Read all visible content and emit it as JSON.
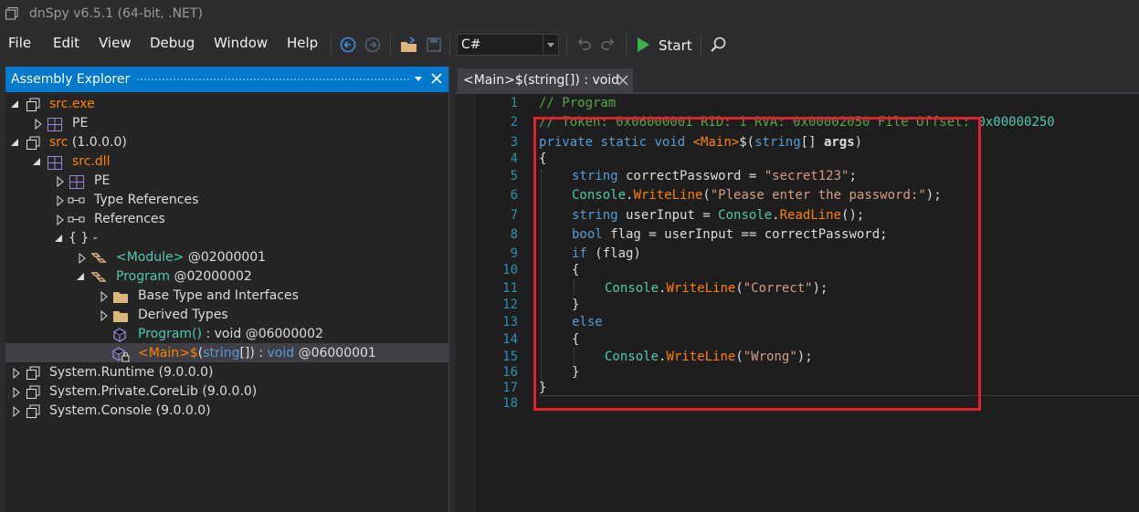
{
  "window": {
    "title": "dnSpy v6.5.1 (64-bit, .NET)"
  },
  "menu": [
    "File",
    "Edit",
    "View",
    "Debug",
    "Window",
    "Help"
  ],
  "toolbar": {
    "language": "C#",
    "start_label": "Start"
  },
  "explorer": {
    "title": "Assembly Explorer",
    "tree": [
      {
        "text": "src.exe",
        "color": "#ff8000"
      },
      {
        "text": "PE",
        "color": "#dcdcdc"
      },
      {
        "text": "src",
        "extra": " (1.0.0.0)",
        "color": "#ff8000"
      },
      {
        "text": "src.dll",
        "color": "#ff8000"
      },
      {
        "text": "PE",
        "color": "#dcdcdc"
      },
      {
        "text": "Type References",
        "color": "#dcdcdc"
      },
      {
        "text": "References",
        "color": "#dcdcdc"
      },
      {
        "text": "{ } -",
        "color": "#dcdcdc"
      },
      {
        "text": "<Module>",
        "extra": " @02000001",
        "color": "#4ec9b0"
      },
      {
        "text": "Program",
        "extra": " @02000002",
        "color": "#4ec9b0"
      },
      {
        "text": "Base Type and Interfaces",
        "color": "#dcdcdc"
      },
      {
        "text": "Derived Types",
        "color": "#dcdcdc"
      },
      {
        "text": "Program()",
        "extra": " @06000002",
        "color": "#4ec9b0"
      },
      {
        "text": "<Main>$",
        "extra": " @06000001",
        "color": "#ff8000"
      },
      {
        "text": "System.Runtime",
        "extra": " (9.0.0.0)",
        "color": "#dcdcdc"
      },
      {
        "text": "System.Private.CoreLib",
        "extra": " (9.0.0.0)",
        "color": "#dcdcdc"
      },
      {
        "text": "System.Console",
        "extra": " (9.0.0.0)",
        "color": "#dcdcdc"
      }
    ],
    "program_ctor_sig": " : void",
    "main_sig_open": "(",
    "main_sig_type": "string",
    "main_sig_close": "[]) : ",
    "main_sig_ret": "void"
  },
  "editor": {
    "tab_label": "<Main>$(string[]) : void",
    "line_numbers": [
      "1",
      "2",
      "3",
      "4",
      "5",
      "6",
      "7",
      "8",
      "9",
      "10",
      "11",
      "12",
      "13",
      "14",
      "15",
      "16",
      "17",
      "18"
    ],
    "lines": {
      "l1": "// Program",
      "l2a": "// Token: 0x06000001 RID: 1 RVA: 0x00002050 File Offset: ",
      "l2b": "0x00000250",
      "l3_private": "private",
      "l3_static": "static",
      "l3_void": "void",
      "l3_main": "<Main>",
      "l3_dollar": "$",
      "l3_paren": "(",
      "l3_string": "string",
      "l3_rest": "[] ",
      "l3_args": "args",
      "l3_close": ")",
      "l4": "{",
      "l5_type": "string",
      "l5_rest": " correctPassword = ",
      "l5_str": "\"secret123\"",
      "l5_end": ";",
      "l6_cls": "Console",
      "l6_dot": ".",
      "l6_m": "WriteLine",
      "l6_open": "(",
      "l6_str": "\"Please enter the password:\"",
      "l6_end": ");",
      "l7_type": "string",
      "l7_rest": " userInput = ",
      "l7_cls": "Console",
      "l7_dot": ".",
      "l7_m": "ReadLine",
      "l7_end": "();",
      "l8_type": "bool",
      "l8_rest": " flag = userInput == correctPassword;",
      "l9_if": "if",
      "l9_rest": " (flag)",
      "l10": "{",
      "l11_cls": "Console",
      "l11_dot": ".",
      "l11_m": "WriteLine",
      "l11_open": "(",
      "l11_str": "\"Correct\"",
      "l11_end": ");",
      "l12": "}",
      "l13": "else",
      "l14": "{",
      "l15_cls": "Console",
      "l15_dot": ".",
      "l15_m": "WriteLine",
      "l15_open": "(",
      "l15_str": "\"Wrong\"",
      "l15_end": ");",
      "l16": "}",
      "l17": "}"
    }
  },
  "colors": {
    "accent": "#007acc",
    "keyword": "#569cd6",
    "comment": "#57a64a",
    "string": "#d69d85",
    "method": "#ff8000",
    "type": "#4ec9b0",
    "highlight_box": "#e0202a"
  }
}
